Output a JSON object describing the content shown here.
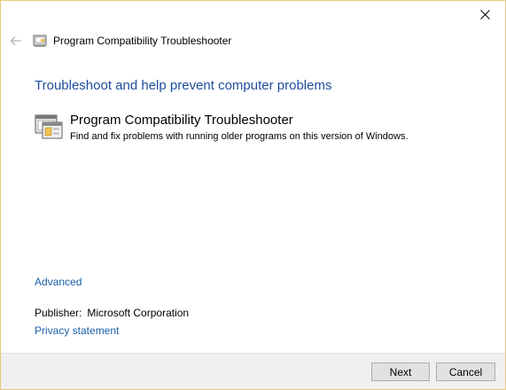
{
  "window": {
    "title": "Program Compatibility Troubleshooter",
    "border_color": "#e8c77a"
  },
  "icons": {
    "back": "arrow-left-icon",
    "close": "close-icon",
    "title": "troubleshooter-icon",
    "tool": "program-compatibility-icon"
  },
  "main": {
    "heading": "Troubleshoot and help prevent computer problems",
    "tool_title": "Program Compatibility Troubleshooter",
    "tool_description": "Find and fix problems with running older programs on this version of Windows.",
    "advanced_label": "Advanced",
    "publisher_label": "Publisher:",
    "publisher_value": "Microsoft Corporation",
    "privacy_label": "Privacy statement"
  },
  "footer": {
    "next_label": "Next",
    "cancel_label": "Cancel"
  },
  "colors": {
    "heading": "#1e4d9b",
    "link": "#1a5fa8",
    "footer_bg": "#f0f0f0"
  }
}
